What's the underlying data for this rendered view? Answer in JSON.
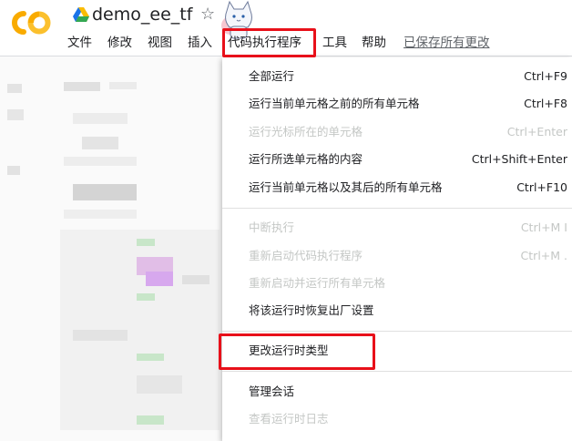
{
  "header": {
    "logo_text": "CO",
    "notebook_title": "demo_ee_tf",
    "star_icon": "star-outline-icon"
  },
  "menubar": {
    "items": [
      "文件",
      "修改",
      "视图",
      "插入",
      "代码执行程序",
      "工具",
      "帮助"
    ],
    "saved_status": "已保存所有更改"
  },
  "runtime_menu": {
    "items": [
      {
        "label": "全部运行",
        "shortcut": "Ctrl+F9",
        "enabled": true
      },
      {
        "label": "运行当前单元格之前的所有单元格",
        "shortcut": "Ctrl+F8",
        "enabled": true
      },
      {
        "label": "运行光标所在的单元格",
        "shortcut": "Ctrl+Enter",
        "enabled": false
      },
      {
        "label": "运行所选单元格的内容",
        "shortcut": "Ctrl+Shift+Enter",
        "enabled": true
      },
      {
        "label": "运行当前单元格以及其后的所有单元格",
        "shortcut": "Ctrl+F10",
        "enabled": true
      },
      {
        "label": "中断执行",
        "shortcut": "Ctrl+M I",
        "enabled": false
      },
      {
        "label": "重新启动代码执行程序",
        "shortcut": "Ctrl+M .",
        "enabled": false
      },
      {
        "label": "重新启动并运行所有单元格",
        "shortcut": "",
        "enabled": false
      },
      {
        "label": "将该运行时恢复出厂设置",
        "shortcut": "",
        "enabled": true
      },
      {
        "label": "更改运行时类型",
        "shortcut": "",
        "enabled": true
      },
      {
        "label": "管理会话",
        "shortcut": "",
        "enabled": true
      },
      {
        "label": "查看运行时日志",
        "shortcut": "",
        "enabled": false
      }
    ]
  },
  "colors": {
    "highlight": "#e8101a",
    "logo_orange": "#f9ab00",
    "logo_yellow": "#fbc02d",
    "disabled_text": "#c4c7c5"
  }
}
